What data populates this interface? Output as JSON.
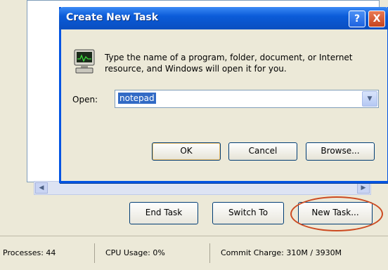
{
  "dialog": {
    "title": "Create New Task",
    "description": "Type the name of a program, folder, document, or Internet resource, and Windows will open it for you.",
    "open_label": "Open:",
    "open_value": "notepad",
    "ok_label": "OK",
    "cancel_label": "Cancel",
    "browse_label": "Browse...",
    "help_glyph": "?",
    "close_glyph": "X"
  },
  "task_manager": {
    "end_task_label": "End Task",
    "switch_to_label": "Switch To",
    "new_task_label": "New Task..."
  },
  "status_bar": {
    "processes": "Processes: 44",
    "cpu_usage": "CPU Usage: 0%",
    "commit_charge": "Commit Charge: 310M / 3930M"
  },
  "colors": {
    "titlebar": "#0b5cd9",
    "highlight_ring": "#cc4a20",
    "selection": "#316ac5"
  },
  "icons": [
    "program-icon",
    "help-icon",
    "close-icon",
    "chevron-down-icon",
    "scroll-left-icon",
    "scroll-right-icon"
  ]
}
